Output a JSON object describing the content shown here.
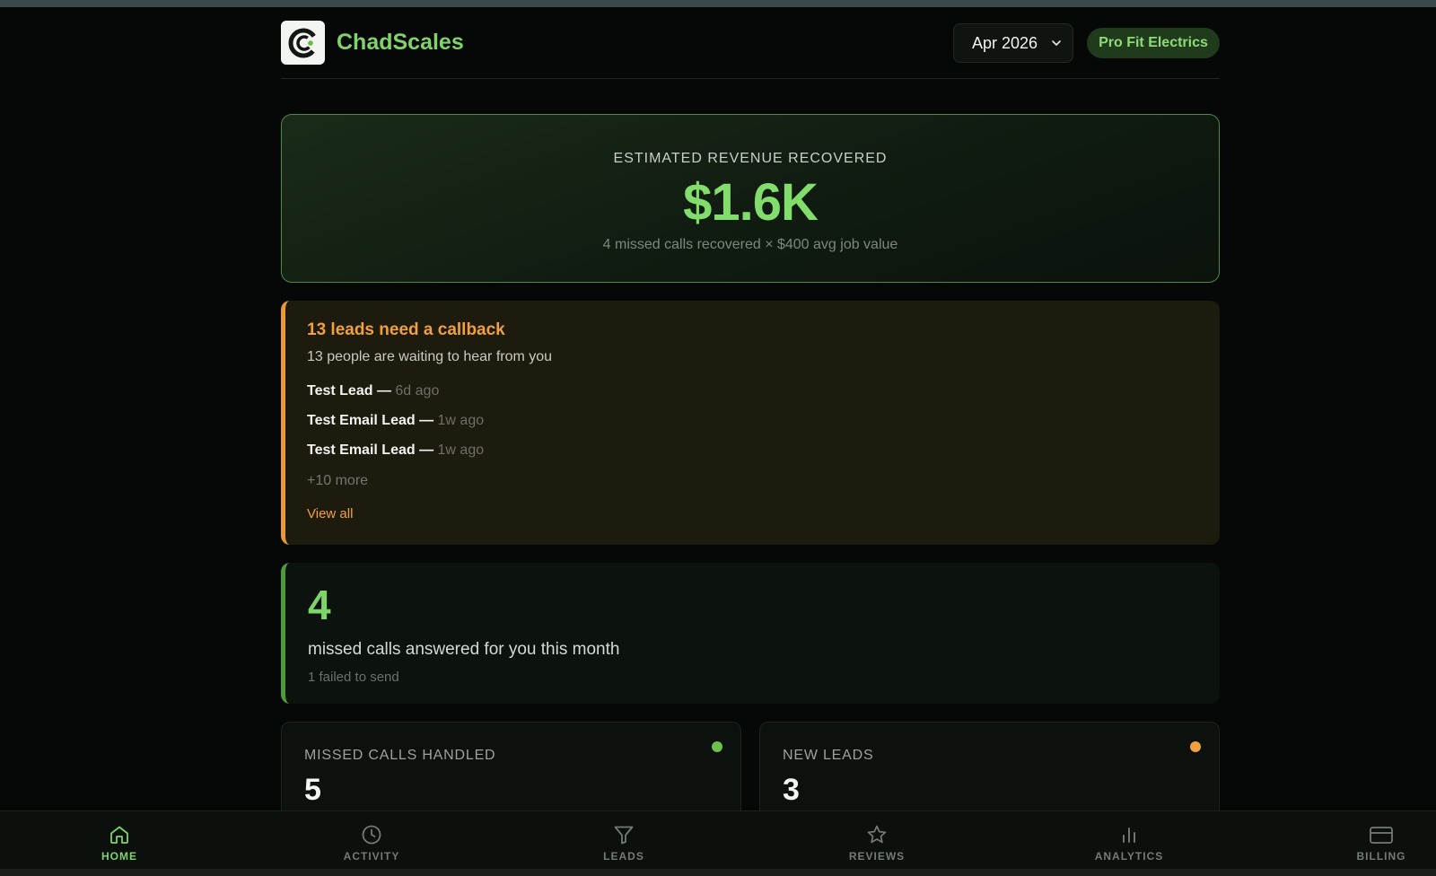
{
  "header": {
    "brand": "ChadScales",
    "month": "Apr 2026",
    "company": "Pro Fit Electrics"
  },
  "revenue": {
    "label": "ESTIMATED REVENUE RECOVERED",
    "value": "$1.6K",
    "subtitle": "4 missed calls recovered × $400 avg job value"
  },
  "callbacks": {
    "title": "13 leads need a callback",
    "subtitle": "13 people are waiting to hear from you",
    "leads": [
      {
        "name": "Test Lead —",
        "age": "6d ago"
      },
      {
        "name": "Test Email Lead —",
        "age": "1w ago"
      },
      {
        "name": "Test Email Lead —",
        "age": "1w ago"
      }
    ],
    "more": "+10 more",
    "view_all": "View all"
  },
  "missed": {
    "count": "4",
    "text": "missed calls answered for you this month",
    "sub": "1 failed to send"
  },
  "stats": [
    {
      "label": "MISSED CALLS HANDLED",
      "value": "5",
      "dot_color": "#6cc24a"
    },
    {
      "label": "NEW LEADS",
      "value": "3",
      "dot_color": "#f0a040"
    }
  ],
  "nav": [
    {
      "label": "HOME",
      "icon": "home-icon",
      "active": true
    },
    {
      "label": "ACTIVITY",
      "icon": "clock-icon"
    },
    {
      "label": "LEADS",
      "icon": "filter-icon"
    },
    {
      "label": "REVIEWS",
      "icon": "star-icon"
    },
    {
      "label": "ANALYTICS",
      "icon": "bar-chart-icon"
    },
    {
      "label": "BILLING",
      "icon": "credit-card-icon"
    }
  ],
  "colors": {
    "accent_green": "#7fd36a",
    "accent_orange": "#f0a040",
    "background": "#050807"
  }
}
